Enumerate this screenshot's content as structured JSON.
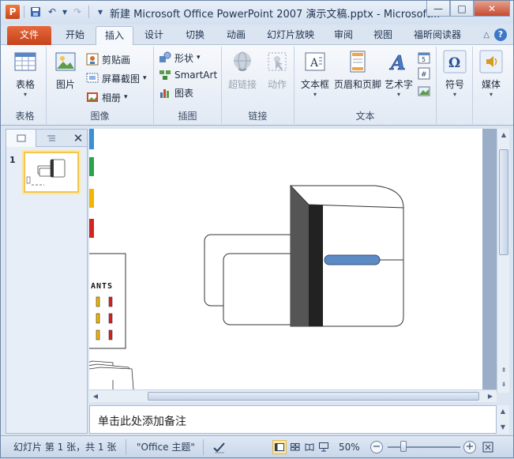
{
  "window": {
    "app_logo": "P",
    "title": "新建 Microsoft Office PowerPoint 2007 演示文稿.pptx - Microsoft...",
    "controls": {
      "minimize": "—",
      "maximize": "□",
      "close": "✕"
    }
  },
  "quick_access": {
    "save_icon": "💾",
    "undo": "↶",
    "undo_dd": "▾",
    "redo": "↷",
    "customize": "▾"
  },
  "tabs": {
    "file": "文件",
    "home": "开始",
    "insert": "插入",
    "design": "设计",
    "transitions": "切换",
    "animations": "动画",
    "slideshow": "幻灯片放映",
    "review": "审阅",
    "view": "视图",
    "foxit": "福昕阅读器",
    "collapse": "△",
    "help": "?"
  },
  "ribbon": {
    "groups": {
      "tables": {
        "label": "表格",
        "table_btn": "表格"
      },
      "images": {
        "label": "图像",
        "picture_btn": "图片",
        "clipart": "剪贴画",
        "screenshot": "屏幕截图",
        "album": "相册"
      },
      "illustrations": {
        "label": "插图",
        "shapes": "形状",
        "smartart": "SmartArt",
        "chart": "图表"
      },
      "links": {
        "label": "链接",
        "hyperlink": "超链接",
        "action": "动作"
      },
      "text": {
        "label": "文本",
        "textbox": "文本框",
        "header_footer": "页眉和页脚",
        "wordart": "艺术字"
      },
      "symbols": {
        "label": "",
        "symbol": "符号"
      },
      "media": {
        "label": "",
        "media": "媒体"
      }
    },
    "dropdown_glyph": "▾"
  },
  "left_pane": {
    "close": "✕",
    "slide_number": "1"
  },
  "slide": {
    "label_text": "ANTS"
  },
  "notes": {
    "placeholder": "单击此处添加备注"
  },
  "status": {
    "slide_info": "幻灯片 第 1 张，共 1 张",
    "theme": "\"Office 主题\"",
    "zoom": "50%",
    "zoom_minus": "−",
    "zoom_plus": "+"
  },
  "colors": {
    "accent": "#c5431b",
    "brand": "#2c4c85",
    "slot_yellow": "#f4b400",
    "slot_red": "#d32424",
    "bar_blue": "#5b8ac4"
  }
}
